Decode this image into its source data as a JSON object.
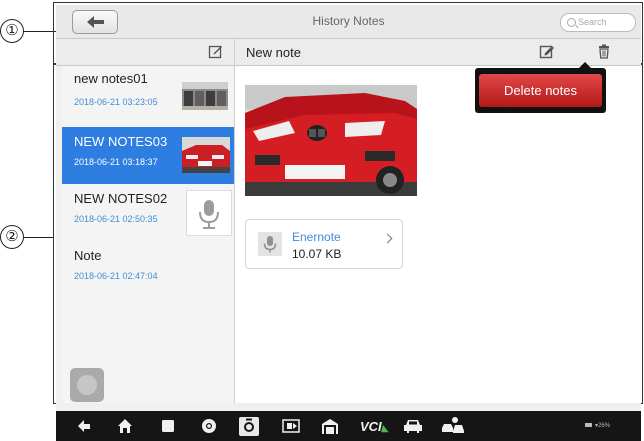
{
  "callouts": [
    "①",
    "②"
  ],
  "app": {
    "title": "History Notes",
    "search_placeholder": "Search"
  },
  "subbar": {
    "title": "New note"
  },
  "notes": [
    {
      "title": "new notes01",
      "date": "2018-06-21 03:23:05",
      "thumb": "garage-photo"
    },
    {
      "title": "NEW NOTES03",
      "date": "2018-06-21 03:18:37",
      "thumb": "red-car-photo",
      "selected": true
    },
    {
      "title": "NEW NOTES02",
      "date": "2018-06-21 02:50:35",
      "thumb": "mic-icon"
    },
    {
      "title": "Note",
      "date": "2018-06-21 02:47:04"
    }
  ],
  "detail": {
    "photo": "red-bmw-car-photo",
    "attachment": {
      "name": "Enernote",
      "size": "10.07 KB"
    }
  },
  "popup": {
    "delete_label": "Delete notes"
  },
  "colors": {
    "selected": "#2e7de1",
    "date": "#3f8ed8",
    "delete": "#c82a2a",
    "navbar": "#151515"
  },
  "navbar": {
    "icons": [
      "back-icon",
      "home-icon",
      "recent-apps-icon",
      "chrome-icon",
      "camera-icon",
      "screen-capture-icon",
      "garage-icon",
      "vci-icon",
      "car-icon",
      "vehicle-tools-icon"
    ],
    "vci_label": "VCI",
    "status": "26%"
  }
}
